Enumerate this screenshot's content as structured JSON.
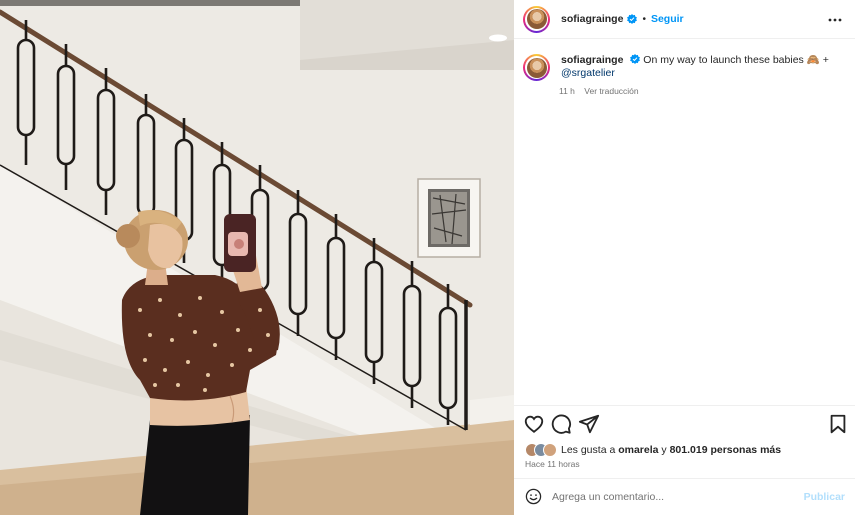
{
  "post": {
    "username": "sofiagrainge",
    "verified": true,
    "follow_separator": "•",
    "follow_label": "Seguir",
    "caption_user": "sofiagrainge",
    "caption_text": "On my way to launch these babies",
    "caption_emoji": "🙈",
    "caption_plus": " +",
    "caption_mention": "@srgatelier",
    "caption_time": "11 h",
    "translate_label": "Ver traducción",
    "likes_prefix": "Les gusta a ",
    "likes_user": "omarela",
    "likes_middle": " y ",
    "likes_count": "801.019 personas más",
    "time_ago": "Hace 11 horas",
    "comment_placeholder": "Agrega un comentario...",
    "publish_label": "Publicar"
  },
  "icons": {
    "more": "more-horizontal-icon",
    "verified": "verified-badge-icon",
    "like": "heart-icon",
    "comment": "comment-icon",
    "share": "send-icon",
    "save": "bookmark-icon",
    "emoji": "smiley-icon"
  },
  "colors": {
    "accent": "#0095f6",
    "publish_disabled": "#b2dffc",
    "text": "#262626",
    "secondary": "#737373",
    "mention": "#00376b"
  }
}
